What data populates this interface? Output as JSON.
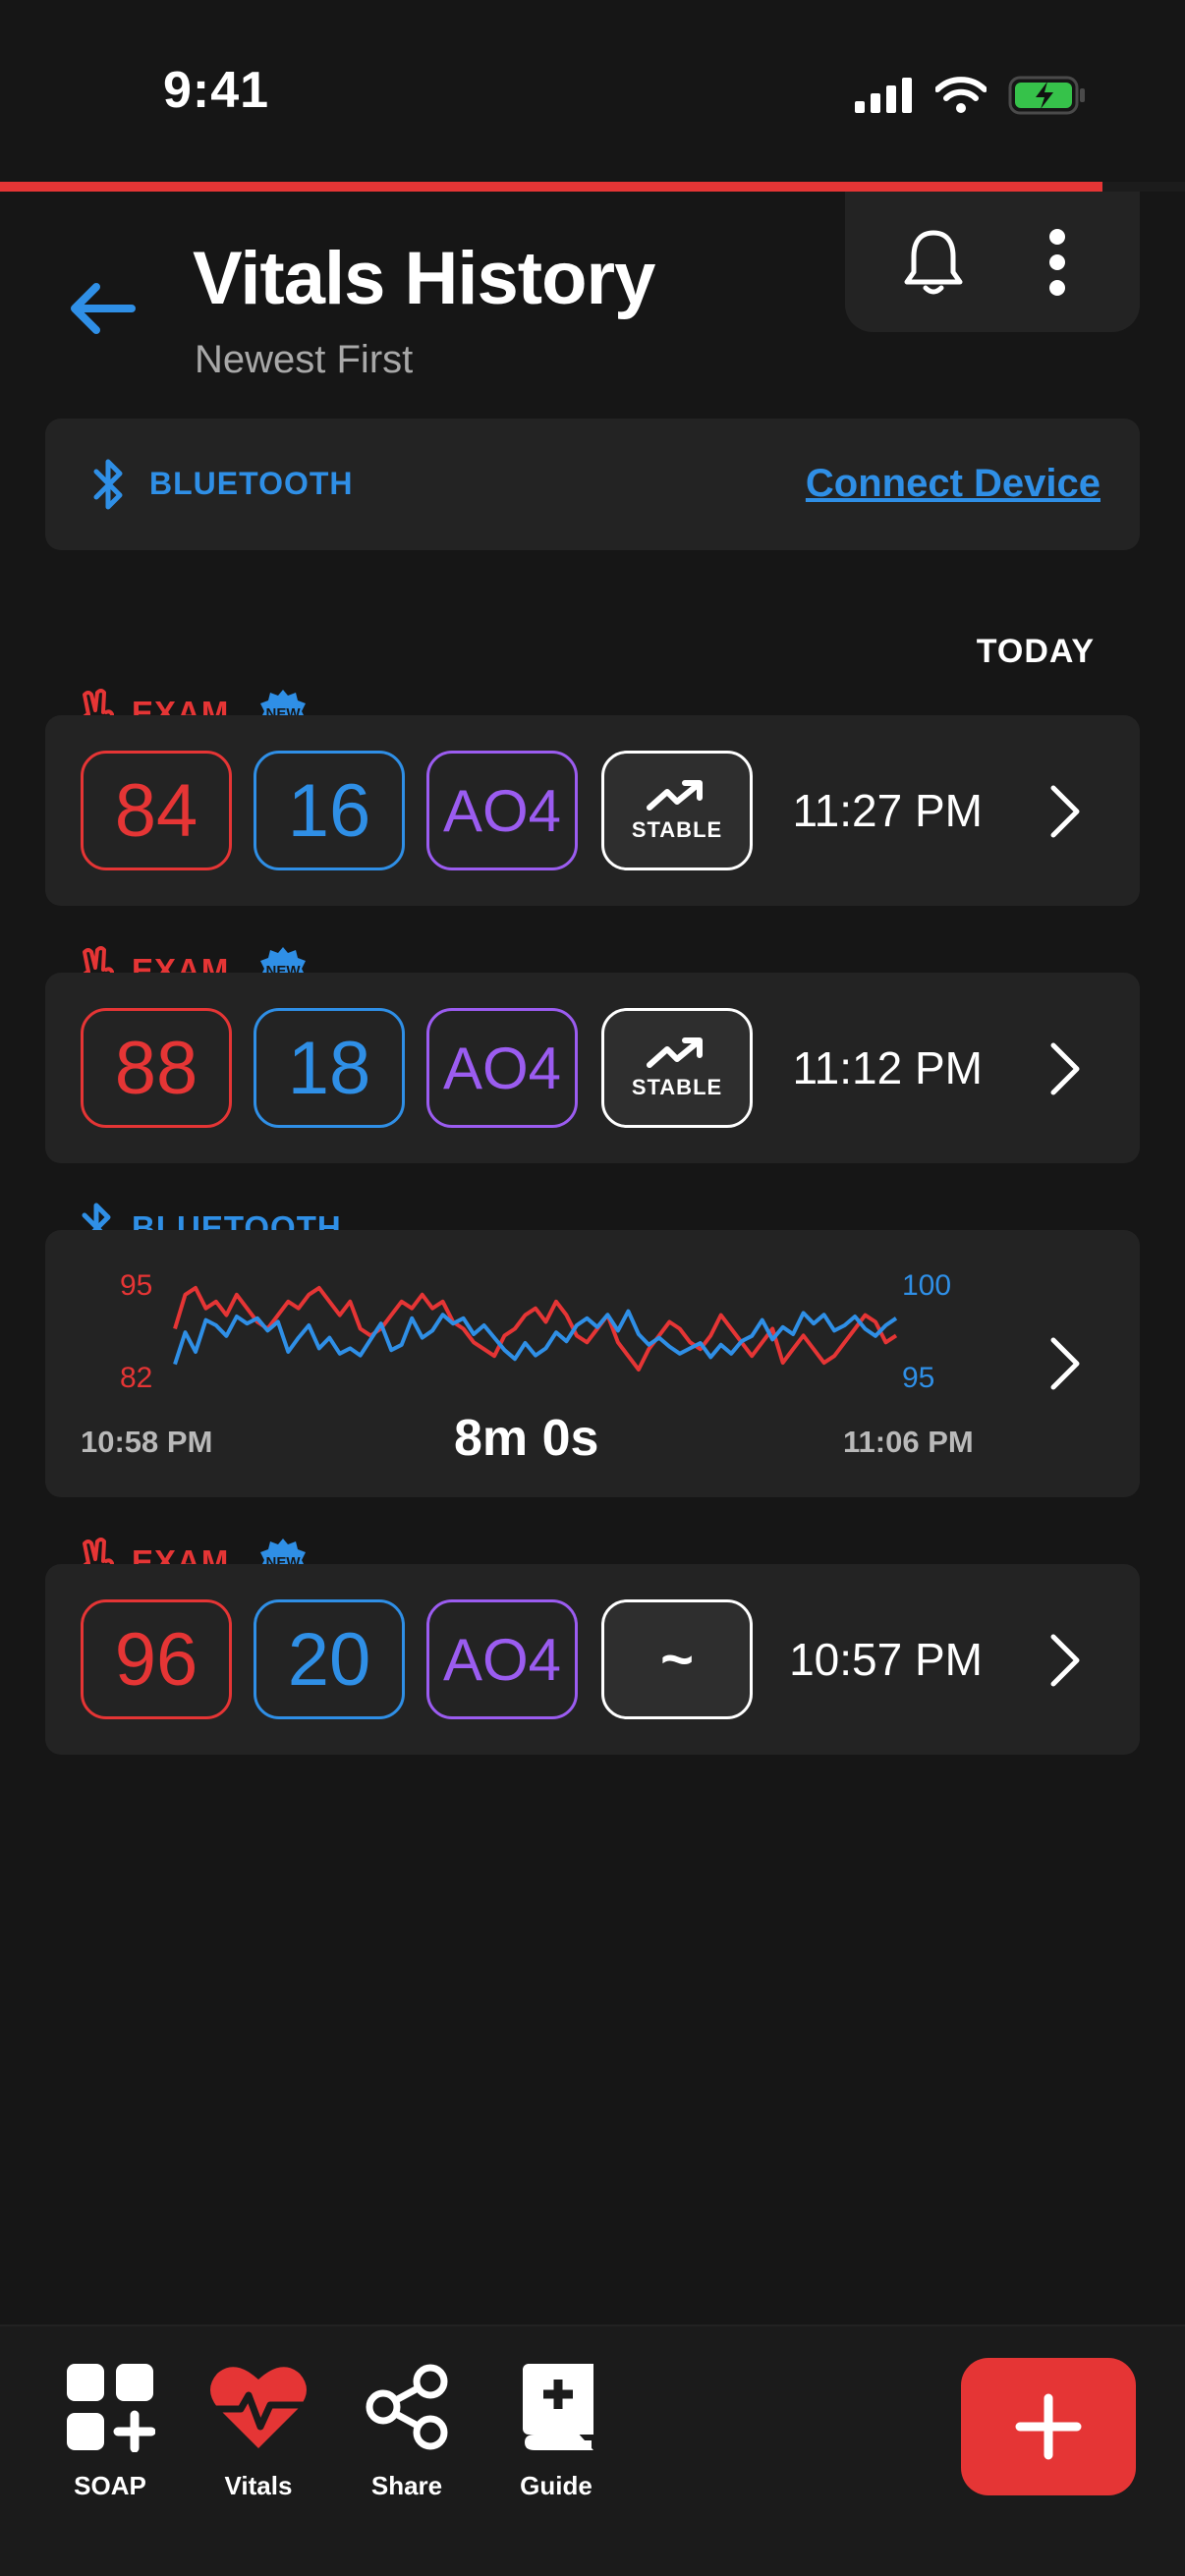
{
  "status_bar": {
    "time": "9:41"
  },
  "progress": {
    "fraction": 0.93
  },
  "header": {
    "title": "Vitals History",
    "subtitle": "Newest First"
  },
  "bluetooth_banner": {
    "label": "BLUETOOTH",
    "action": "Connect Device"
  },
  "section": {
    "label": "TODAY"
  },
  "badge": {
    "new": "NEW"
  },
  "records": [
    {
      "tag": "EXAM",
      "heart_rate": "84",
      "resp_rate": "16",
      "ao": "AO4",
      "trend": "STABLE",
      "time": "11:27 PM"
    },
    {
      "tag": "EXAM",
      "heart_rate": "88",
      "resp_rate": "18",
      "ao": "AO4",
      "trend": "STABLE",
      "time": "11:12 PM"
    },
    {
      "tag": "EXAM",
      "heart_rate": "96",
      "resp_rate": "20",
      "ao": "AO4",
      "trend": "~",
      "time": "10:57 PM"
    }
  ],
  "bluetooth_session": {
    "tag": "BLUETOOTH",
    "start": "10:58 PM",
    "end": "11:06 PM",
    "duration": "8m 0s",
    "left_axis": {
      "max": "95",
      "min": "82"
    },
    "right_axis": {
      "max": "100",
      "min": "95"
    }
  },
  "chart_data": {
    "type": "line",
    "x_range": [
      "10:58 PM",
      "11:06 PM"
    ],
    "series": [
      {
        "axis": "left",
        "ylim": [
          82,
          95
        ],
        "color": "#e53535",
        "values": [
          88,
          93,
          94,
          91,
          92,
          90,
          93,
          91,
          89,
          88,
          90,
          92,
          91,
          93,
          94,
          92,
          90,
          92,
          88,
          87,
          88,
          90,
          92,
          91,
          93,
          91,
          92,
          89,
          88,
          86,
          85,
          84,
          87,
          88,
          90,
          91,
          89,
          92,
          90,
          87,
          86,
          88,
          90,
          86,
          84,
          82,
          85,
          87,
          89,
          88,
          86,
          85,
          87,
          90,
          88,
          86,
          84,
          86,
          88,
          83,
          85,
          87,
          85,
          83,
          84,
          86,
          88,
          90,
          89,
          86,
          87
        ],
        "marker": "rgb"
      },
      {
        "axis": "right",
        "ylim": [
          95,
          100
        ],
        "color": "#2f8fe6",
        "values": [
          95.3,
          97.1,
          96.0,
          97.8,
          97.5,
          96.9,
          98.0,
          97.6,
          97.9,
          97.2,
          97.7,
          96.0,
          96.8,
          97.5,
          96.2,
          96.8,
          95.9,
          96.2,
          95.8,
          96.7,
          97.6,
          96.1,
          96.4,
          97.9,
          96.8,
          97.2,
          98.1,
          97.6,
          97.9,
          97.0,
          97.5,
          96.8,
          96.1,
          95.6,
          96.5,
          95.8,
          96.2,
          97.1,
          96.6,
          97.5,
          97.9,
          97.4,
          98.1,
          97.2,
          98.3,
          97.0,
          96.4,
          96.8,
          96.3,
          95.9,
          96.2,
          96.5,
          95.7,
          96.4,
          95.9,
          96.6,
          96.9,
          97.8,
          96.7,
          97.4,
          97.0,
          98.2,
          97.6,
          98.1,
          97.2,
          97.5,
          98.0,
          97.3,
          96.9,
          97.5,
          97.9
        ]
      }
    ]
  },
  "nav": {
    "soap": "SOAP",
    "vitals": "Vitals",
    "share": "Share",
    "guide": "Guide"
  },
  "colors": {
    "accent_red": "#e53535",
    "accent_blue": "#2f8fe6",
    "accent_purple": "#9b5cf0",
    "background": "#161616",
    "card": "#232323"
  },
  "icons": [
    "back-arrow-icon",
    "bell-icon",
    "more-vertical-icon",
    "bluetooth-icon",
    "hand-icon",
    "new-badge-icon",
    "trending-up-icon",
    "chevron-right-icon",
    "soap-grid-icon",
    "heart-pulse-icon",
    "share-icon",
    "guide-book-icon",
    "plus-icon"
  ]
}
